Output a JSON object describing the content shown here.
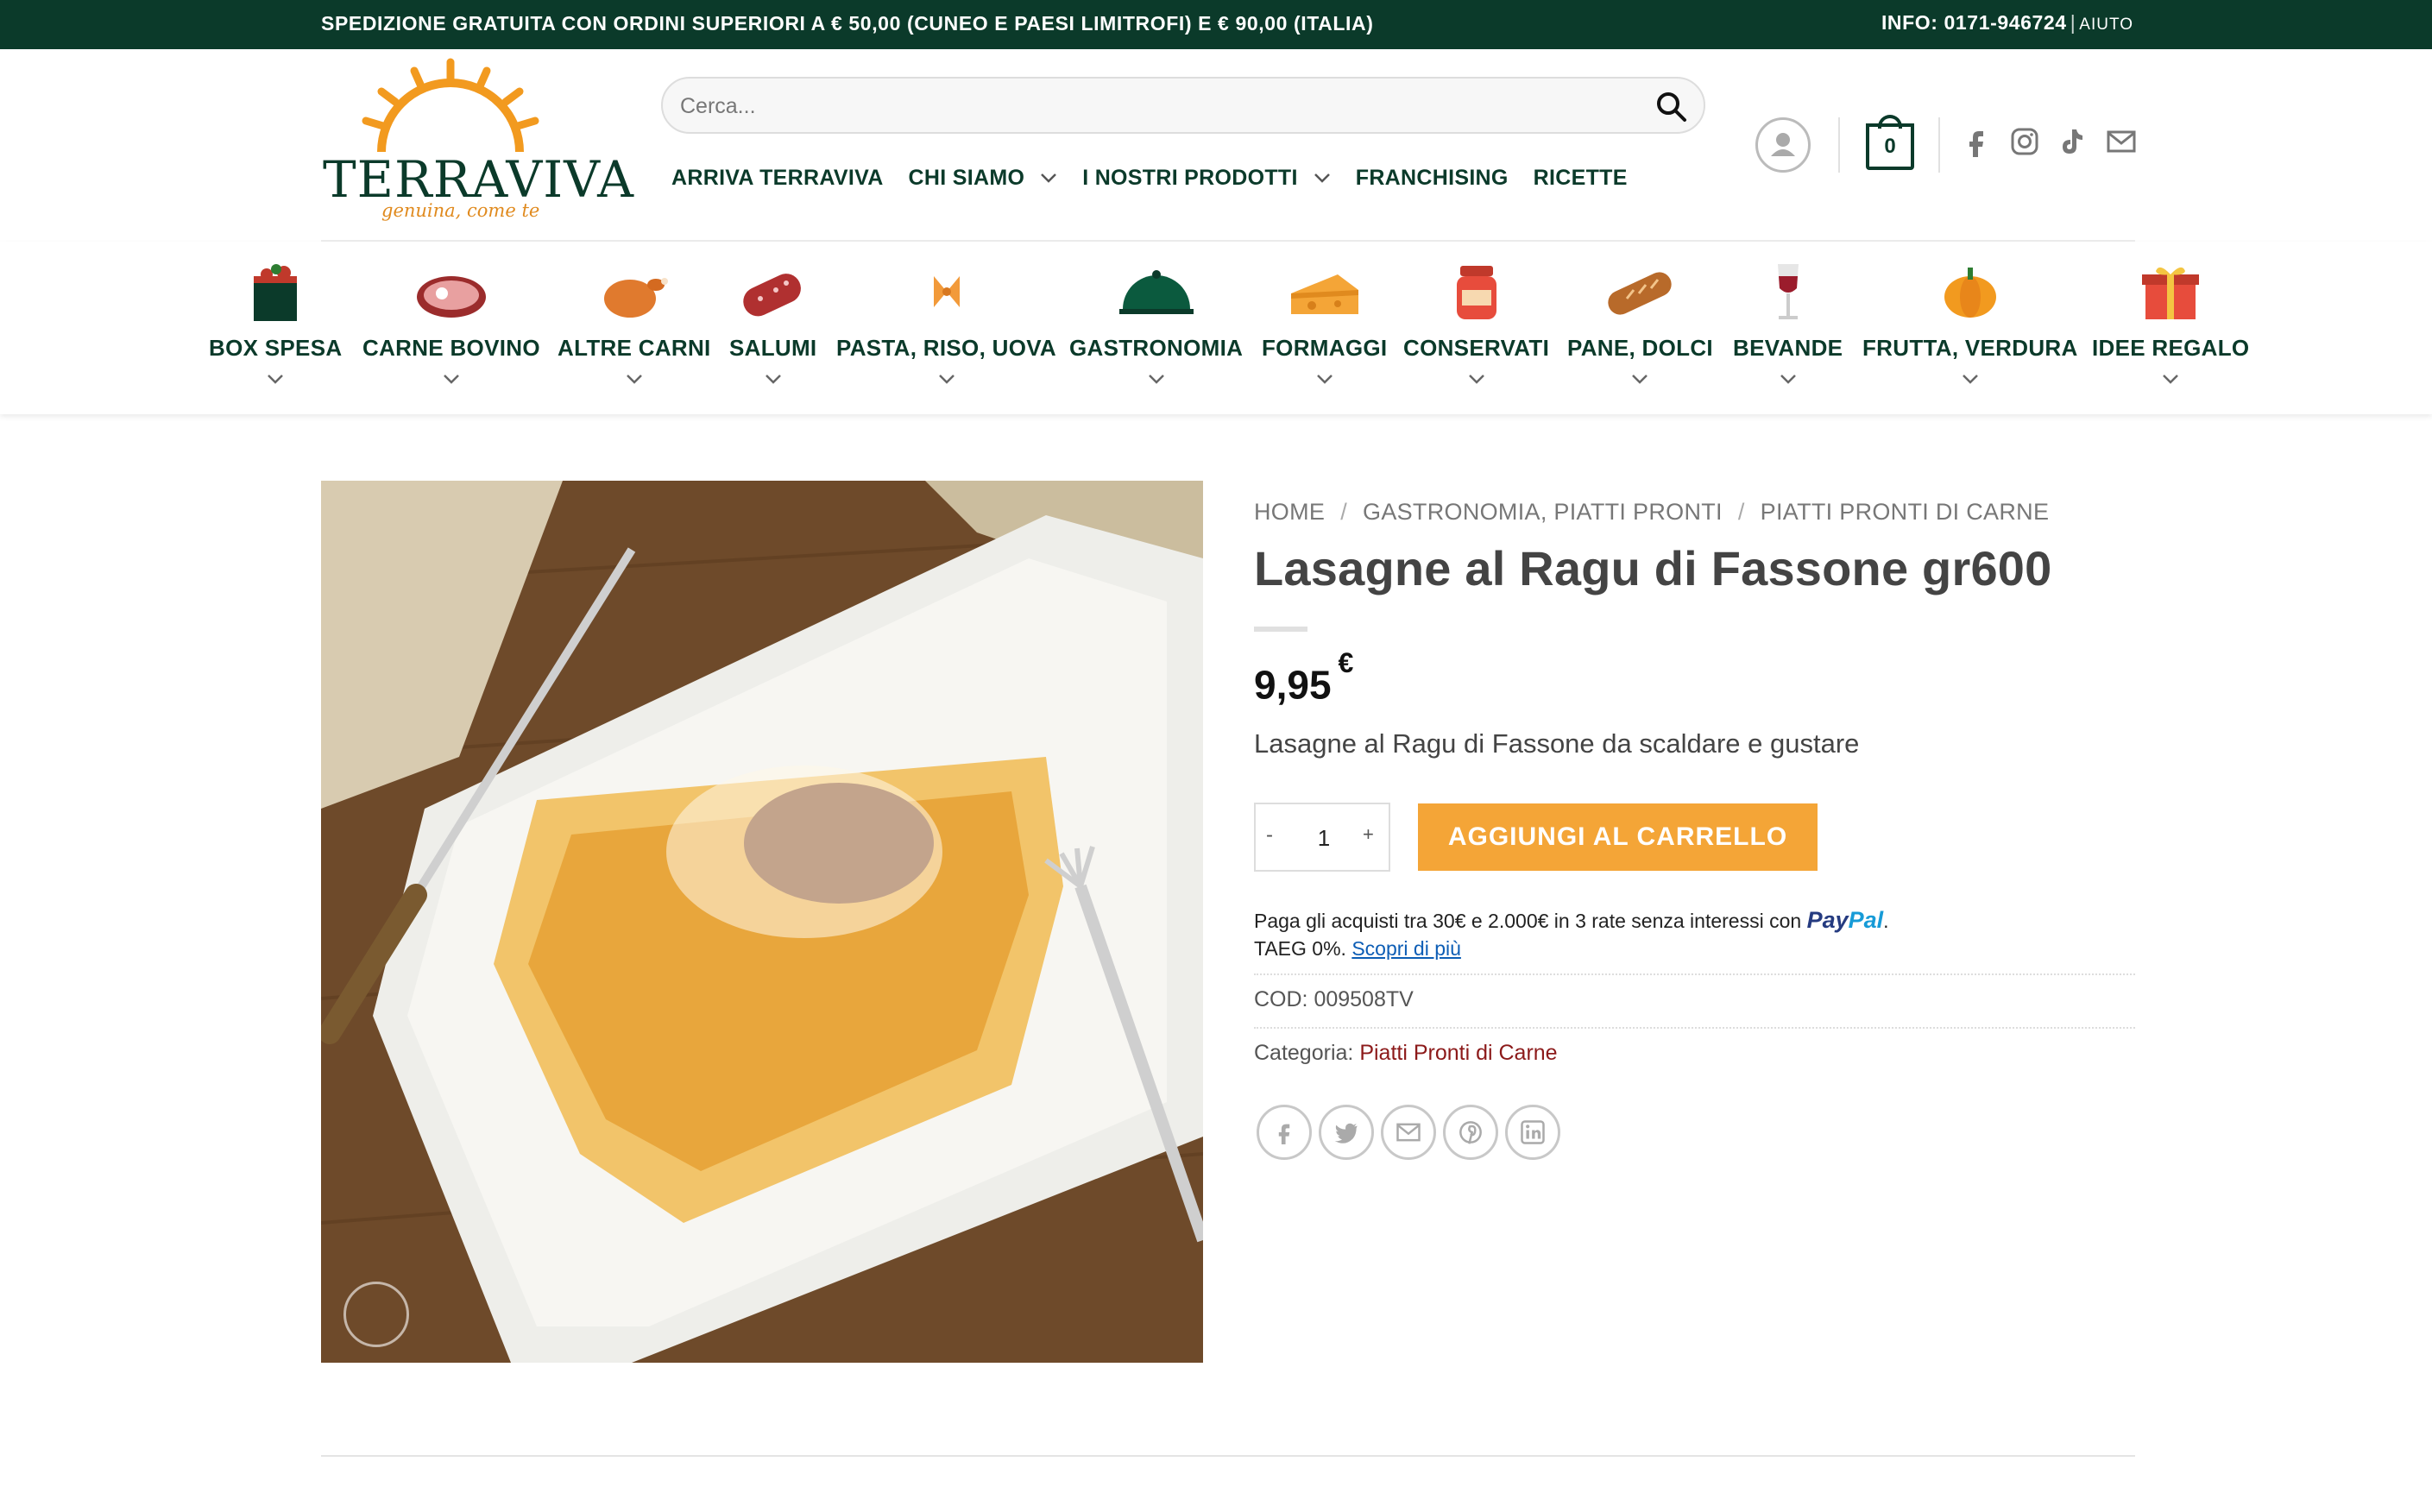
{
  "topbar": {
    "shipping": "SPEDIZIONE GRATUITA CON ORDINI SUPERIORI A € 50,00 (CUNEO E PAESI LIMITROFI) E € 90,00 (ITALIA)",
    "info": "INFO: 0171-946724",
    "separator": "|",
    "help": "AIUTO"
  },
  "logo": {
    "brand": "TERRAVIVA",
    "tagline": "genuina, come te"
  },
  "search": {
    "placeholder": "Cerca..."
  },
  "mainnav": [
    {
      "label": "ARRIVA TERRAVIVA",
      "has_dropdown": false
    },
    {
      "label": "CHI SIAMO",
      "has_dropdown": true
    },
    {
      "label": "I NOSTRI PRODOTTI",
      "has_dropdown": true
    },
    {
      "label": "FRANCHISING",
      "has_dropdown": false
    },
    {
      "label": "RICETTE",
      "has_dropdown": false
    }
  ],
  "cart": {
    "count": "0"
  },
  "categories": [
    {
      "label": "BOX SPESA",
      "icon": "box-spesa-icon"
    },
    {
      "label": "CARNE BOVINO",
      "icon": "steak-icon"
    },
    {
      "label": "ALTRE CARNI",
      "icon": "roast-chicken-icon"
    },
    {
      "label": "SALUMI",
      "icon": "salami-icon"
    },
    {
      "label": "PASTA, RISO, UOVA",
      "icon": "farfalle-pasta-icon"
    },
    {
      "label": "GASTRONOMIA",
      "icon": "cloche-icon"
    },
    {
      "label": "FORMAGGI",
      "icon": "cheese-icon"
    },
    {
      "label": "CONSERVATI",
      "icon": "jar-icon"
    },
    {
      "label": "PANE, DOLCI",
      "icon": "bread-icon"
    },
    {
      "label": "BEVANDE",
      "icon": "wine-glass-icon"
    },
    {
      "label": "FRUTTA, VERDURA",
      "icon": "pumpkin-icon"
    },
    {
      "label": "IDEE REGALO",
      "icon": "gift-icon"
    }
  ],
  "breadcrumb": [
    "HOME",
    "GASTRONOMIA, PIATTI PRONTI",
    "PIATTI PRONTI DI CARNE"
  ],
  "breadcrumb_sep": "/",
  "product": {
    "title": "Lasagne al Ragu di Fassone gr600",
    "price": "9,95",
    "currency": "€",
    "short_description": "Lasagne al Ragu di Fassone da scaldare e gustare",
    "quantity": "1",
    "qty_minus": "-",
    "qty_plus": "+",
    "add_to_cart": "AGGIUNGI AL CARRELLO",
    "sku": "COD: 009508TV",
    "category_label": "Categoria:",
    "category": "Piatti Pronti di Carne"
  },
  "paypal": {
    "line1": "Paga gli acquisti tra 30€ e 2.000€ in 3 rate senza interessi con",
    "brand_a": "Pay",
    "brand_b": "Pal",
    "period": ".",
    "line2": "TAEG 0%.",
    "link": "Scopri di più"
  },
  "colors": {
    "primary": "#0b3a2a",
    "accent": "#f4a537",
    "link": "#8c1a1a"
  }
}
